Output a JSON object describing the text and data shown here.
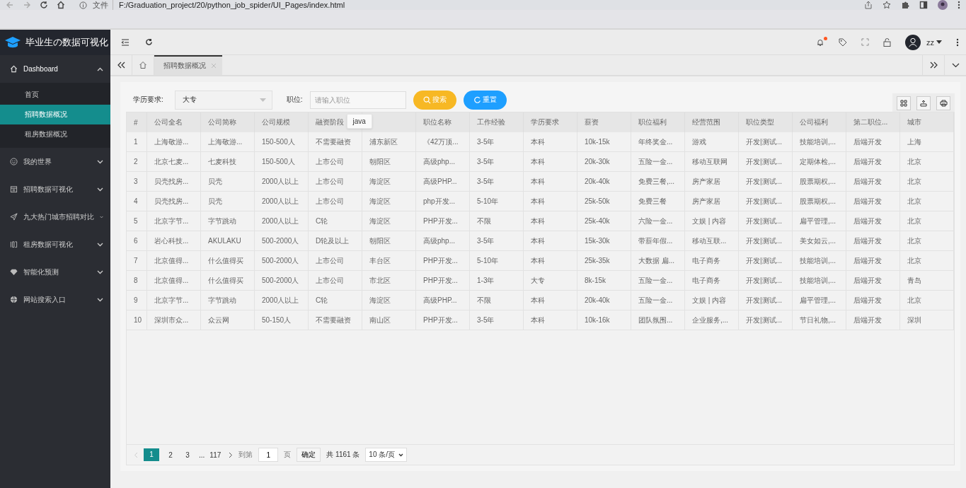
{
  "browser": {
    "scheme_label": "文件",
    "url": "F:/Graduation_project/20/python_job_spider/UI_Pages/index.html"
  },
  "app": {
    "title": "毕业生の数据可视化"
  },
  "sidebar": {
    "items": [
      {
        "label": "Dashboard",
        "expanded": true,
        "children": [
          {
            "label": "首页",
            "selected": false
          },
          {
            "label": "招聘数据概况",
            "selected": true
          },
          {
            "label": "租房数据概况",
            "selected": false
          }
        ]
      },
      {
        "label": "我的世界",
        "expanded": false
      },
      {
        "label": "招聘数据可视化",
        "expanded": false
      },
      {
        "label": "九大热门城市招聘对比",
        "expanded": false
      },
      {
        "label": "租房数据可视化",
        "expanded": false
      },
      {
        "label": "智能化预测",
        "expanded": false
      },
      {
        "label": "网站搜索入口",
        "expanded": false
      }
    ]
  },
  "header": {
    "user": "zz",
    "notification": true
  },
  "tabs": [
    {
      "label": "招聘数据概况",
      "selected": true
    }
  ],
  "filters": {
    "education": {
      "label": "学历要求:",
      "value": "大专"
    },
    "position": {
      "label": "职位:",
      "placeholder": "请输入职位",
      "suggestions": [
        "java"
      ]
    },
    "search_button": "搜索",
    "reset_button": "重置"
  },
  "table": {
    "columns": [
      "#",
      "公司全名",
      "公司简称",
      "公司规模",
      "融资阶段",
      null,
      "职位名称",
      "工作经验",
      "学历要求",
      "薪资",
      "职位福利",
      "经营范围",
      "职位类型",
      "公司福利",
      "第二职位...",
      "城市"
    ],
    "rows": [
      [
        "1",
        "上海敬游...",
        "上海敬游...",
        "150-500人",
        "不需要融资",
        "浦东新区",
        "《42万顶...",
        "3-5年",
        "本科",
        "10k-15k",
        "年终奖金...",
        "游戏",
        "开发|测试...",
        "技能培训,...",
        "后端开发",
        "上海"
      ],
      [
        "2",
        "北京七麦...",
        "七麦科技",
        "150-500人",
        "上市公司",
        "朝阳区",
        "高级php...",
        "3-5年",
        "本科",
        "20k-30k",
        "五险一金...",
        "移动互联网",
        "开发|测试...",
        "定期体检,...",
        "后端开发",
        "北京"
      ],
      [
        "3",
        "贝壳找房...",
        "贝壳",
        "2000人以上",
        "上市公司",
        "海淀区",
        "高级PHP...",
        "3-5年",
        "本科",
        "20k-40k",
        "免费三餐,...",
        "房产家居",
        "开发|测试...",
        "股票期权,...",
        "后端开发",
        "北京"
      ],
      [
        "4",
        "贝壳找房...",
        "贝壳",
        "2000人以上",
        "上市公司",
        "海淀区",
        "php开发...",
        "5-10年",
        "本科",
        "25k-50k",
        "免费三餐",
        "房产家居",
        "开发|测试...",
        "股票期权,...",
        "后端开发",
        "北京"
      ],
      [
        "5",
        "北京字节...",
        "字节跳动",
        "2000人以上",
        "C轮",
        "海淀区",
        "PHP开发...",
        "不限",
        "本科",
        "25k-40k",
        "六险一金...",
        "文娱 | 内容",
        "开发|测试...",
        "扁平管理,...",
        "后端开发",
        "北京"
      ],
      [
        "6",
        "岩心科技...",
        "AKULAKU",
        "500-2000人",
        "D轮及以上",
        "朝阳区",
        "高级php...",
        "3-5年",
        "本科",
        "15k-30k",
        "带薪年假...",
        "移动互联...",
        "开发|测试...",
        "美女如云,...",
        "后端开发",
        "北京"
      ],
      [
        "7",
        "北京值得...",
        "什么值得买",
        "500-2000人",
        "上市公司",
        "丰台区",
        "PHP开发...",
        "5-10年",
        "本科",
        "25k-35k",
        "大数据 扁...",
        "电子商务",
        "开发|测试...",
        "技能培训,...",
        "后端开发",
        "北京"
      ],
      [
        "8",
        "北京值得...",
        "什么值得买",
        "500-2000人",
        "上市公司",
        "市北区",
        "PHP开发...",
        "1-3年",
        "大专",
        "8k-15k",
        "五险一金...",
        "电子商务",
        "开发|测试...",
        "技能培训,...",
        "后端开发",
        "青岛"
      ],
      [
        "9",
        "北京字节...",
        "字节跳动",
        "2000人以上",
        "C轮",
        "海淀区",
        "高级PHP...",
        "不限",
        "本科",
        "20k-40k",
        "五险一金...",
        "文娱 | 内容",
        "开发|测试...",
        "扁平管理,...",
        "后端开发",
        "北京"
      ],
      [
        "10",
        "深圳市众...",
        "众云网",
        "50-150人",
        "不需要融资",
        "南山区",
        "PHP开发...",
        "3-5年",
        "本科",
        "10k-16k",
        "团队氛围...",
        "企业服务,...",
        "开发|测试...",
        "节日礼物,...",
        "后端开发",
        "深圳"
      ]
    ]
  },
  "pagination": {
    "pages": [
      {
        "label": "1",
        "selected": true
      },
      {
        "label": "2",
        "selected": false
      },
      {
        "label": "3",
        "selected": false
      },
      {
        "label": "117",
        "selected": false
      }
    ],
    "ellipsis": "...",
    "goto_label": "到第",
    "goto_value": "1",
    "page_unit": "页",
    "confirm": "确定",
    "total": "共 1161 条",
    "page_size": "10 条/页"
  }
}
